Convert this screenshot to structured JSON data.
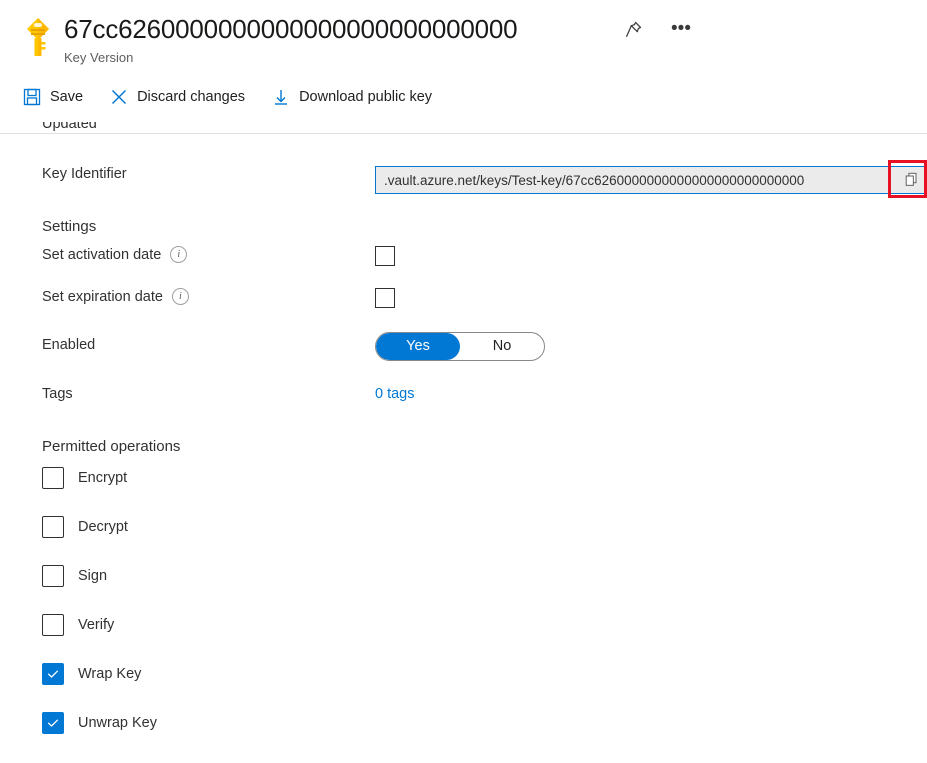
{
  "header": {
    "title": "67cc6260000000000000000000000000",
    "subtitle": "Key Version",
    "pin_label": "Pin",
    "more_label": "•••"
  },
  "commandbar": {
    "items": [
      {
        "label": "Save",
        "icon": "save-icon"
      },
      {
        "label": "Discard changes",
        "icon": "close-x-icon"
      },
      {
        "label": "Download public key",
        "icon": "download-icon"
      }
    ]
  },
  "form": {
    "updated_label": "Updated",
    "key_identifier": {
      "label": "Key Identifier",
      "value": ".vault.azure.net/keys/Test-key/67cc6260000000000000000000000000",
      "copy_tooltip": "Copy to clipboard"
    },
    "settings": {
      "heading": "Settings",
      "set_activation_date": {
        "label": "Set activation date",
        "checked": false
      },
      "set_expiration_date": {
        "label": "Set expiration date",
        "checked": false
      },
      "enabled": {
        "label": "Enabled",
        "yes_label": "Yes",
        "no_label": "No",
        "value": "Yes"
      },
      "tags": {
        "label": "Tags",
        "value": "0 tags"
      }
    },
    "permitted_operations": {
      "heading": "Permitted operations",
      "items": [
        {
          "label": "Encrypt",
          "checked": false
        },
        {
          "label": "Decrypt",
          "checked": false
        },
        {
          "label": "Sign",
          "checked": false
        },
        {
          "label": "Verify",
          "checked": false
        },
        {
          "label": "Wrap Key",
          "checked": true
        },
        {
          "label": "Unwrap Key",
          "checked": true
        }
      ]
    }
  },
  "colors": {
    "accent": "#0078d4",
    "highlight": "#e81123",
    "key_icon": "#ffd000"
  }
}
